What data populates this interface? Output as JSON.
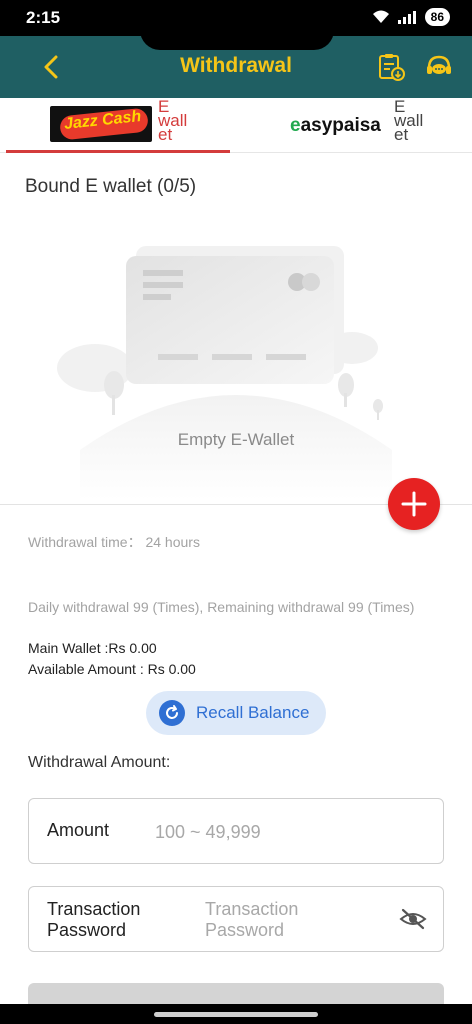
{
  "status_bar": {
    "time": "2:15",
    "battery": "86"
  },
  "header": {
    "title": "Withdrawal"
  },
  "tabs": [
    {
      "brand": "Jazz Cash",
      "label": "E wall et",
      "active": true
    },
    {
      "brand": "easypaisa",
      "label": "E wall et",
      "active": false
    }
  ],
  "wallets": {
    "bound_title": "Bound E wallet (0/5)",
    "empty_text": "Empty E-Wallet"
  },
  "info": {
    "withdrawal_time": "Withdrawal time：  24 hours",
    "daily": "Daily withdrawal 99 (Times), Remaining withdrawal 99 (Times)",
    "main_wallet": "Main Wallet :Rs 0.00",
    "available": "Available Amount : Rs 0.00"
  },
  "recall_button": {
    "label": "Recall Balance"
  },
  "form": {
    "section_label": "Withdrawal Amount:",
    "amount_label": "Amount",
    "amount_placeholder": "100 ~ 49,999",
    "password_label": "Transaction Password",
    "password_placeholder": "Transaction Password"
  },
  "colors": {
    "header_bg": "#1f5f63",
    "title": "#f5c518",
    "accent_red": "#e62222",
    "recall_blue": "#2f6fd3"
  },
  "icons": [
    "back-chevron-icon",
    "record-clipboard-icon",
    "customer-service-icon",
    "card-placeholder-icon",
    "plus-icon",
    "refresh-icon",
    "eye-off-icon"
  ]
}
